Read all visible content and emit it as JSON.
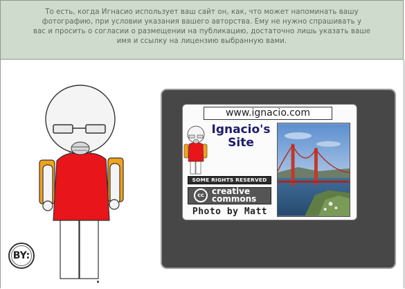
{
  "banner": {
    "lines": [
      "То есть, когда Игнасио использует ваш сайт он, как, что может напоминать вашу",
      "фотографию, при условии указания вашего авторства. Ему не нужно спрашивать у",
      "вас и просить о согласии о размещении на публикацию, достаточно лишь указать ваше",
      "имя и ссылку на лицензию выбранную вами."
    ]
  },
  "badge": {
    "label": "BY:"
  },
  "card": {
    "url": "www.ignacio.com",
    "title_line1": "Ignacio's",
    "title_line2": "Site",
    "rights": "SOME RIGHTS RESERVED",
    "cc_logo": "cc",
    "cc_word1": "creative",
    "cc_word2": "commons",
    "credit": "Photo by Matt"
  },
  "colors": {
    "banner_bg": "#cfdccd",
    "frame_bg": "#474747",
    "shirt": "#e8151b",
    "backpack": "#f3a21a",
    "site_title": "#1c1c6c"
  },
  "icons": {
    "person": "stick-figure-with-glasses",
    "license": "cc-by-badge",
    "photo": "golden-gate-bridge-photo"
  }
}
